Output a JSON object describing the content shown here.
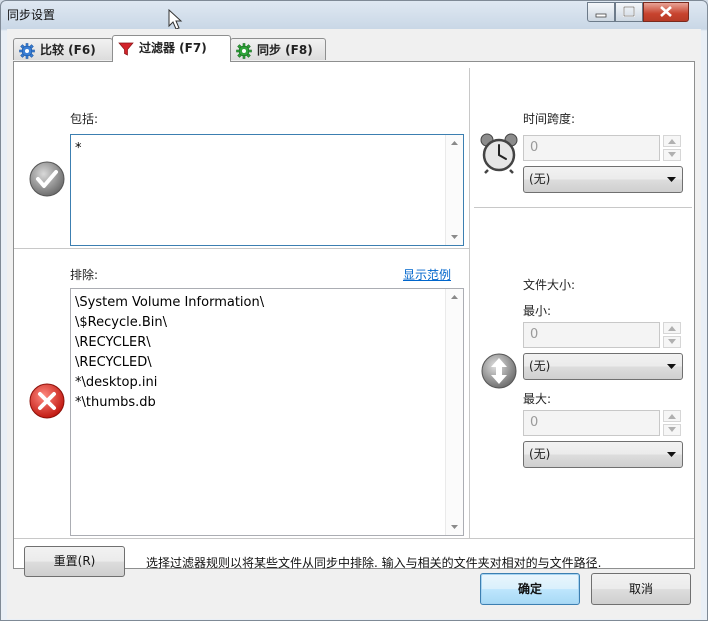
{
  "window": {
    "title": "同步设置",
    "accent": "#c7432e"
  },
  "tabs": [
    {
      "label": "比较 (F6)",
      "icon": "gear-blue-icon",
      "active": false
    },
    {
      "label": "过滤器 (F7)",
      "icon": "filter-funnel-icon",
      "active": true
    },
    {
      "label": "同步 (F8)",
      "icon": "gear-green-icon",
      "active": false
    }
  ],
  "include": {
    "label": "包括:",
    "value": "*",
    "icon": "checkmark-icon"
  },
  "exclude": {
    "label": "排除:",
    "show_example": "显示范例",
    "value": "\\System Volume Information\\\n\\$Recycle.Bin\\\n\\RECYCLER\\\n\\RECYCLED\\\n*\\desktop.ini\n*\\thumbs.db",
    "icon": "cross-icon"
  },
  "time_span": {
    "label": "时间跨度:",
    "value": "0",
    "unit": "(无)",
    "icon": "alarm-clock-icon"
  },
  "file_size": {
    "label": "文件大小:",
    "min_label": "最小:",
    "min_value": "0",
    "min_unit": "(无)",
    "max_label": "最大:",
    "max_value": "0",
    "max_unit": "(无)",
    "icon": "up-down-arrows-icon"
  },
  "footer": {
    "reset_label": "重置(R)",
    "hint": "选择过滤器规则以将某些文件从同步中排除. 输入与相关的文件夹对相对的与文件路径."
  },
  "dialog": {
    "ok_label": "确定",
    "cancel_label": "取消"
  }
}
